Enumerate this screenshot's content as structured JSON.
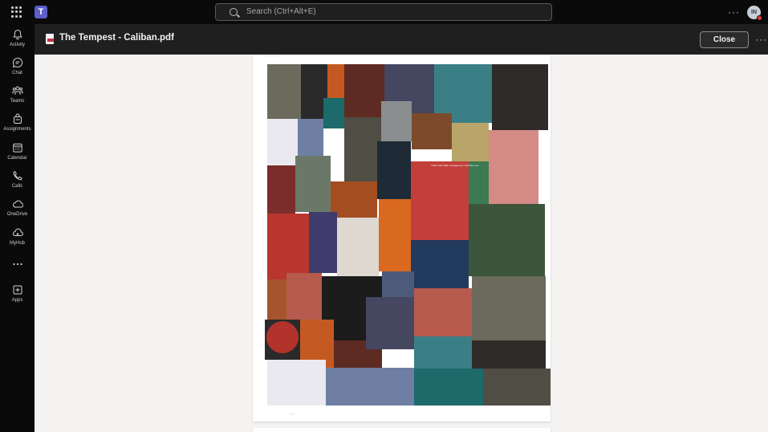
{
  "topbar": {
    "search_placeholder": "Search (Ctrl+Alt+E)",
    "more_label": "···",
    "avatar_initials": "IN"
  },
  "rail": {
    "items": [
      {
        "label": "Activity",
        "icon": "bell-icon"
      },
      {
        "label": "Chat",
        "icon": "chat-icon"
      },
      {
        "label": "Teams",
        "icon": "teams-icon"
      },
      {
        "label": "Assignments",
        "icon": "assignments-icon"
      },
      {
        "label": "Calendar",
        "icon": "calendar-icon"
      },
      {
        "label": "Calls",
        "icon": "phone-icon"
      },
      {
        "label": "OneDrive",
        "icon": "cloud-icon"
      },
      {
        "label": "MyHub",
        "icon": "myhub-icon"
      },
      {
        "label": "",
        "icon": "more-icon"
      },
      {
        "label": "Apps",
        "icon": "apps-icon"
      }
    ]
  },
  "header": {
    "file_title": "The Tempest - Caliban.pdf",
    "close_label": "Close",
    "more_label": "···"
  },
  "document": {
    "page_header": "—— ———— · ——",
    "page_footer": "———",
    "collage_caption": "That's bad cable management. Pull them out",
    "tile_colors": [
      "#6b6a5c",
      "#2a2a2a",
      "#c45a22",
      "#5e2b22",
      "#45465f",
      "#3a7f86",
      "#2f2b2a",
      "#e9e9ef",
      "#6e7fa3",
      "#1d6a6a",
      "#4f4d44",
      "#8b8e8f",
      "#7c4a2a",
      "#b9a56a",
      "#d48a85",
      "#7a2d2a",
      "#6b7868",
      "#a34d21",
      "#1e2b36",
      "#c23f3a",
      "#3b7a52",
      "#b8362d",
      "#3f3b6c",
      "#ded8d0",
      "#d9691f",
      "#223a5e",
      "#3d553a",
      "#a5552d",
      "#b65a4d",
      "#1c1c1c",
      "#4d5a7a",
      "#b85a4e"
    ]
  }
}
